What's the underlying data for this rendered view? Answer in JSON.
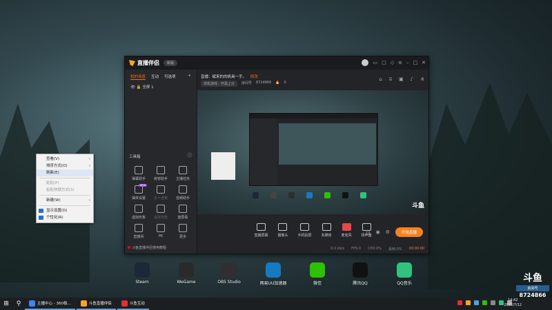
{
  "context_menu": {
    "items": [
      {
        "label": "查看(V)",
        "submenu": true,
        "disabled": false
      },
      {
        "label": "排序方式(O)",
        "submenu": true,
        "disabled": false
      },
      {
        "label": "刷新(E)",
        "submenu": false,
        "disabled": false,
        "highlight": true
      },
      {
        "label": "粘贴(P)",
        "submenu": false,
        "disabled": true
      },
      {
        "label": "粘贴快捷方式(S)",
        "submenu": false,
        "disabled": true
      },
      {
        "label": "新建(W)",
        "submenu": true,
        "disabled": false
      },
      {
        "label": "显示设置(D)",
        "submenu": false,
        "disabled": false,
        "icon": "display-icon"
      },
      {
        "label": "个性化(R)",
        "submenu": false,
        "disabled": false,
        "icon": "personalize-icon"
      }
    ]
  },
  "app": {
    "name": "直播伴侣",
    "version_pill": "新版",
    "sidebar": {
      "tabs": [
        "我的场景",
        "互动",
        "可选项"
      ],
      "scene_label": "全屏 1",
      "tools_title": "工具箱",
      "tools": [
        {
          "label": "弹幕助手"
        },
        {
          "label": "房管助手"
        },
        {
          "label": "主播任务"
        },
        {
          "label": "抽奖设置",
          "badge": "NEW"
        },
        {
          "label": "多人连麦",
          "dim": true
        },
        {
          "label": "音频助手"
        },
        {
          "label": "虚拟形象"
        },
        {
          "label": "虚拟背景",
          "dim": true
        },
        {
          "label": "旋屏看"
        },
        {
          "label": "直播间"
        },
        {
          "label": "PK"
        },
        {
          "label": "更多"
        }
      ],
      "tip": "斗鱼直播伴侣使用教程"
    },
    "room": {
      "title": "直播：赋来的的帆具一手。",
      "edit": "修改",
      "category": "单机游戏 - 开黑上分",
      "room_no_label": "房间号",
      "room_no": "8724866",
      "hot": "0"
    },
    "watermark": "斗鱼",
    "controls": [
      {
        "label": "直播屏幕"
      },
      {
        "label": "摄像头"
      },
      {
        "label": "手机投屏"
      },
      {
        "label": "多媒体"
      },
      {
        "label": "麦克风",
        "red": true
      },
      {
        "label": "扬声器"
      }
    ],
    "start_button": "开始直播",
    "status": {
      "bitrate": "0.0 kb/s",
      "fps": "FPS:0",
      "cpu": "CPU:0%",
      "drop": "丢帧:0%",
      "time": "00:00:00"
    }
  },
  "desktop_icons": [
    {
      "label": "Steam",
      "color": "#1b2838"
    },
    {
      "label": "WeGame",
      "color": "#2a2a2a"
    },
    {
      "label": "OBS Studio",
      "color": "#302e31"
    },
    {
      "label": "网易UU加速器",
      "color": "#1679c4"
    },
    {
      "label": "微信",
      "color": "#2dc100"
    },
    {
      "label": "腾讯QQ",
      "color": "#111111"
    },
    {
      "label": "QQ音乐",
      "color": "#31c27c"
    }
  ],
  "taskbar": {
    "apps": [
      {
        "label": "主播中心 - 360极...",
        "color": "#4285f4"
      },
      {
        "label": "斗鱼直播伴侣",
        "color": "#f5a623"
      },
      {
        "label": "斗鱼互动",
        "color": "#e03030"
      }
    ],
    "time": "14:42",
    "date": "2022/7/12"
  },
  "room_badge": {
    "brand": "斗鱼",
    "label": "房间号",
    "number": "8724866"
  }
}
